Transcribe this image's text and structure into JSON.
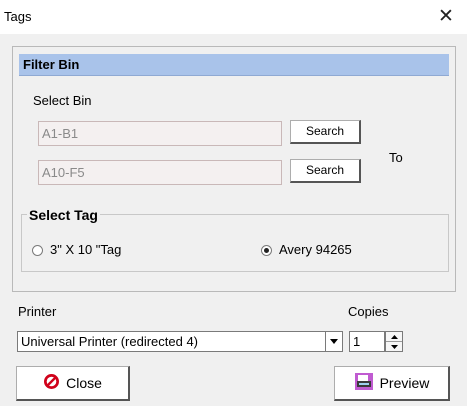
{
  "window": {
    "title": "Tags",
    "close_glyph": "✕"
  },
  "filter_bin": {
    "header": "Filter Bin",
    "select_label": "Select Bin",
    "from_value": "A1-B1",
    "to_value": "A10-F5",
    "search_label_1": "Search",
    "search_label_2": "Search",
    "to_label": "To"
  },
  "select_tag": {
    "legend": "Select Tag",
    "options": [
      {
        "label": "3\" X 10 \"Tag",
        "selected": false
      },
      {
        "label": "Avery 94265",
        "selected": true
      }
    ]
  },
  "printer": {
    "label": "Printer",
    "selected": "Universal Printer  (redirected 4)"
  },
  "copies": {
    "label": "Copies",
    "value": "1"
  },
  "buttons": {
    "close": "Close",
    "preview": "Preview"
  },
  "icons": {
    "close_icon": "no-entry-icon",
    "preview_icon": "printer-preview-icon"
  },
  "colors": {
    "header_bg": "#a9c3ea",
    "close_icon_red": "#d0021b"
  }
}
